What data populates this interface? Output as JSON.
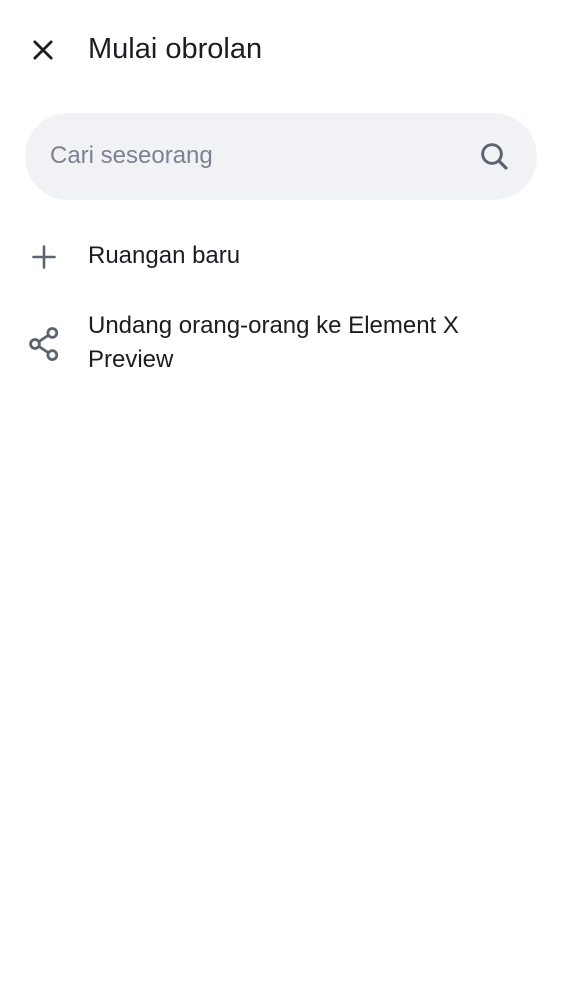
{
  "header": {
    "close_icon": "close-icon",
    "title": "Mulai obrolan"
  },
  "search": {
    "placeholder": "Cari seseorang",
    "value": "",
    "icon": "search-icon"
  },
  "actions": [
    {
      "icon": "plus-icon",
      "label": "Ruangan baru"
    },
    {
      "icon": "share-icon",
      "label": "Undang orang-orang ke Element X Preview"
    }
  ],
  "colors": {
    "icon": "#5c6370",
    "text": "#1b1d22",
    "search_bg": "#f0f2f5",
    "placeholder": "#7c8290"
  }
}
